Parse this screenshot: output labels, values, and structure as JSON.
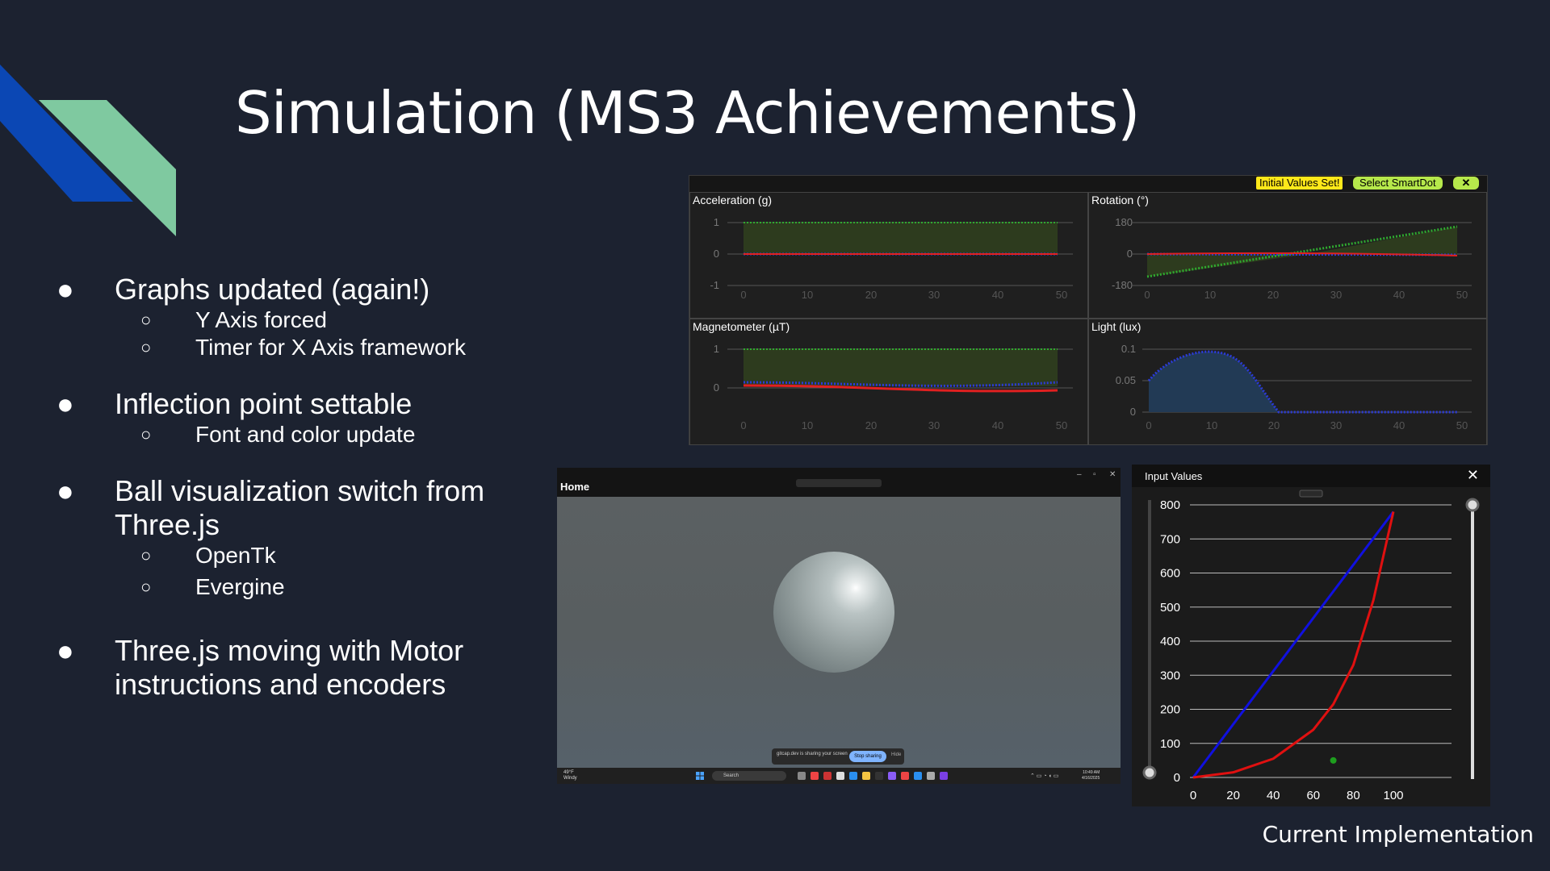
{
  "slide": {
    "title": "Simulation (MS3 Achievements)",
    "caption": "Current Implementation",
    "accent_colors": {
      "dark_blue": "#0b47b4",
      "mint": "#7fc9a0"
    }
  },
  "bullets": [
    {
      "text": "Graphs updated (again!)",
      "sub": [
        "Y Axis forced",
        "Timer for X Axis framework"
      ]
    },
    {
      "text": "Inflection point settable",
      "sub": [
        "Font and color update"
      ]
    },
    {
      "text": "Ball visualization switch from Three.js",
      "sub": [
        "OpenTk",
        "Evergine"
      ]
    },
    {
      "text": "Three.js moving with Motor instructions and encoders",
      "sub": []
    }
  ],
  "bullet_glyph": "●",
  "sub_glyph": "○",
  "dashboard": {
    "buttons": {
      "initial": "Initial Values Set!",
      "select": "Select SmartDot",
      "close": "✕"
    },
    "panels": [
      {
        "title": "Acceleration (g)",
        "yticks": [
          "1",
          "0",
          "-1"
        ],
        "xticks": [
          "0",
          "10",
          "20",
          "30",
          "40",
          "50"
        ]
      },
      {
        "title": "Rotation (°)",
        "yticks": [
          "180",
          "0",
          "-180"
        ],
        "xticks": [
          "0",
          "10",
          "20",
          "30",
          "40",
          "50"
        ]
      },
      {
        "title": "Magnetometer (µT)",
        "yticks": [
          "1",
          "0"
        ],
        "xticks": [
          "0",
          "10",
          "20",
          "30",
          "40",
          "50"
        ]
      },
      {
        "title": "Light (lux)",
        "yticks": [
          "0.1",
          "0.05",
          "0"
        ],
        "xticks": [
          "0",
          "10",
          "20",
          "30",
          "40",
          "50"
        ]
      }
    ]
  },
  "home_window": {
    "title": "Home",
    "share_text": "gitcap.dev is sharing your screen",
    "share_button": "Stop sharing",
    "hide": "Hide",
    "search": "Search",
    "weather": "49°F\nWindy",
    "clock": "10:49 AM\n4/16/2025",
    "controls": [
      "–",
      "▫",
      "✕"
    ]
  },
  "input_values": {
    "title": "Input Values",
    "close": "✕",
    "chart_data": {
      "type": "line",
      "x_ticks": [
        "0",
        "20",
        "40",
        "60",
        "80",
        "100"
      ],
      "y_ticks": [
        "0",
        "100",
        "200",
        "300",
        "400",
        "500",
        "600",
        "700",
        "800"
      ],
      "xlim": [
        0,
        100
      ],
      "ylim": [
        0,
        800
      ],
      "series": [
        {
          "color": "#1010e0",
          "x": [
            0,
            100
          ],
          "y": [
            0,
            780
          ]
        },
        {
          "color": "#e01010",
          "x": [
            0,
            20,
            40,
            60,
            70,
            80,
            90,
            100
          ],
          "y": [
            0,
            15,
            55,
            140,
            215,
            330,
            520,
            780
          ]
        }
      ],
      "point": {
        "x": 70,
        "y": 50,
        "color": "#1e9e1e"
      }
    }
  }
}
